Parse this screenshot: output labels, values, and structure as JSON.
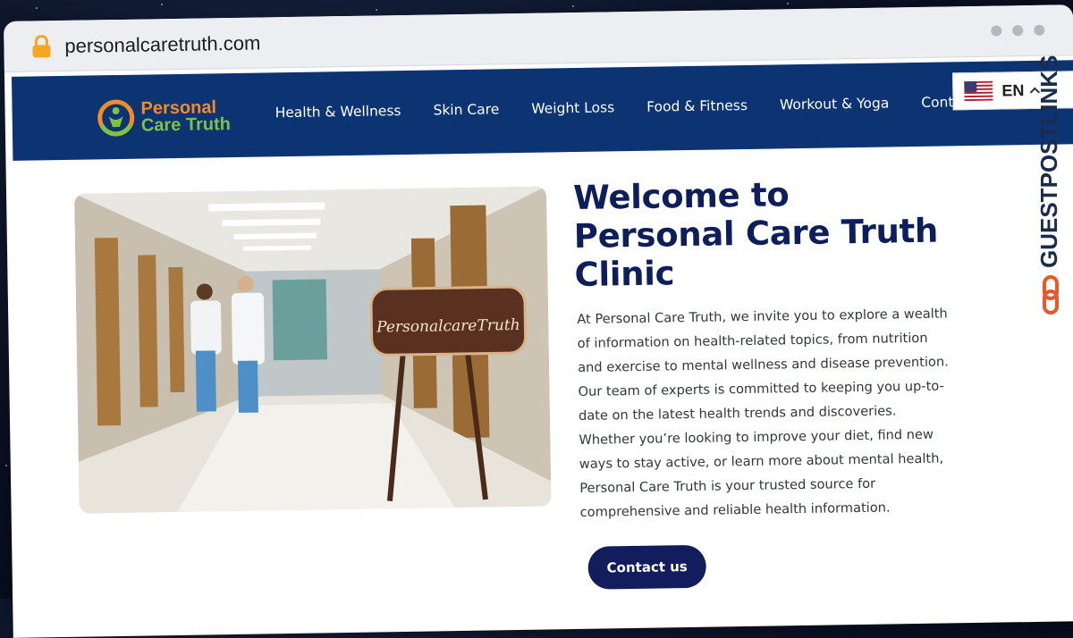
{
  "browser": {
    "url": "personalcaretruth.com"
  },
  "site": {
    "logo": {
      "line1": "Personal",
      "line2": "Care Truth"
    },
    "nav": {
      "items": [
        {
          "label": "Health & Wellness"
        },
        {
          "label": "Skin Care"
        },
        {
          "label": "Weight Loss"
        },
        {
          "label": "Food & Fitness"
        },
        {
          "label": "Workout & Yoga"
        },
        {
          "label": "Contact US"
        }
      ]
    },
    "language": {
      "code": "EN",
      "flag": "us-flag-icon"
    }
  },
  "hero": {
    "image_sign": "PersonalcareTruth",
    "headline": "Welcome to Personal Care Truth Clinic",
    "body": "At Personal Care Truth, we invite you to explore a wealth of information on health-related topics, from nutrition and exercise to mental wellness and disease prevention. Our team of experts is committed to keeping you up-to-date on the latest health trends and discoveries. Whether you’re looking to improve your diet, find new ways to stay active, or learn more about mental health, Personal Care Truth is your trusted source for comprehensive and reliable health information.",
    "cta_label": "Contact us"
  },
  "watermark": {
    "text": "GUESTPOSTLINKS"
  },
  "colors": {
    "nav_bg": "#0c3473",
    "headline": "#0e1e5b",
    "cta_bg": "#111d5c",
    "logo_orange": "#f28b28",
    "logo_green": "#7fc241",
    "watermark": "#e8582a"
  }
}
